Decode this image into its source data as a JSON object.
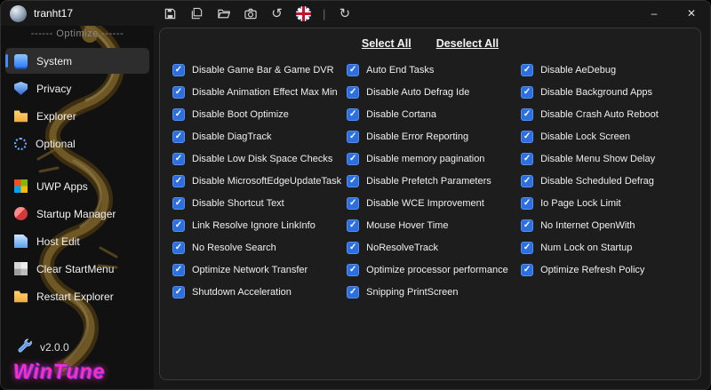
{
  "titlebar": {
    "user": "tranht17",
    "toolbar_icons": [
      "save-icon",
      "save-copy-icon",
      "open-folder-icon",
      "screenshot-icon",
      "undo-icon",
      "language-flag-icon",
      "refresh-icon"
    ],
    "undo_glyph": "↺",
    "refresh_glyph": "↻",
    "separator_glyph": "|",
    "minimize_label": "–",
    "close_label": "✕"
  },
  "sidebar": {
    "section_label": "------ Optimize ------",
    "items": [
      {
        "label": "System",
        "icon": "system",
        "selected": true
      },
      {
        "label": "Privacy",
        "icon": "privacy"
      },
      {
        "label": "Explorer",
        "icon": "explorer"
      },
      {
        "label": "Optional",
        "icon": "optional"
      },
      {
        "label": "UWP Apps",
        "icon": "uwp-apps",
        "gap_before": true
      },
      {
        "label": "Startup Manager",
        "icon": "startup-manager"
      },
      {
        "label": "Host Edit",
        "icon": "host-edit"
      },
      {
        "label": "Clear StartMenu",
        "icon": "clear-startmenu"
      },
      {
        "label": "Restart Explorer",
        "icon": "restart-explorer"
      }
    ],
    "version": "v2.0.0",
    "brand": "WinTune"
  },
  "main": {
    "select_all_label": "Select All",
    "deselect_all_label": "Deselect All",
    "checkmark_glyph": "✓",
    "columns": [
      {
        "items": [
          {
            "label": "Disable Game Bar & Game DVR",
            "checked": true
          },
          {
            "label": "Disable Animation Effect Max Min",
            "checked": true
          },
          {
            "label": "Disable Boot Optimize",
            "checked": true
          },
          {
            "label": "Disable DiagTrack",
            "checked": true
          },
          {
            "label": "Disable Low Disk Space Checks",
            "checked": true
          },
          {
            "label": "Disable MicrosoftEdgeUpdateTask",
            "checked": true
          },
          {
            "label": "Disable Shortcut Text",
            "checked": true
          },
          {
            "label": "Link Resolve Ignore LinkInfo",
            "checked": true
          },
          {
            "label": "No Resolve Search",
            "checked": true
          },
          {
            "label": "Optimize Network Transfer",
            "checked": true
          },
          {
            "label": "Shutdown Acceleration",
            "checked": true
          }
        ]
      },
      {
        "items": [
          {
            "label": "Auto End Tasks",
            "checked": true
          },
          {
            "label": "Disable Auto Defrag Ide",
            "checked": true
          },
          {
            "label": "Disable Cortana",
            "checked": true
          },
          {
            "label": "Disable Error Reporting",
            "checked": true
          },
          {
            "label": "Disable memory pagination",
            "checked": true
          },
          {
            "label": "Disable Prefetch Parameters",
            "checked": true
          },
          {
            "label": "Disable WCE Improvement",
            "checked": true
          },
          {
            "label": "Mouse Hover Time",
            "checked": true
          },
          {
            "label": "NoResolveTrack",
            "checked": true
          },
          {
            "label": "Optimize processor performance",
            "checked": true
          },
          {
            "label": "Snipping PrintScreen",
            "checked": true
          }
        ]
      },
      {
        "items": [
          {
            "label": "Disable AeDebug",
            "checked": true
          },
          {
            "label": "Disable Background Apps",
            "checked": true
          },
          {
            "label": "Disable Crash Auto Reboot",
            "checked": true
          },
          {
            "label": "Disable Lock Screen",
            "checked": true
          },
          {
            "label": "Disable Menu Show Delay",
            "checked": true
          },
          {
            "label": "Disable Scheduled Defrag",
            "checked": true
          },
          {
            "label": "Io Page Lock Limit",
            "checked": true
          },
          {
            "label": "No Internet OpenWith",
            "checked": true
          },
          {
            "label": "Num Lock on Startup",
            "checked": true
          },
          {
            "label": "Optimize Refresh Policy",
            "checked": true
          }
        ]
      }
    ]
  },
  "colors": {
    "accent": "#4a8af4",
    "checkbox": "#2e6fdf",
    "brand_pink": "#ff2fb4",
    "panel_bg": "#1d1d1d"
  }
}
